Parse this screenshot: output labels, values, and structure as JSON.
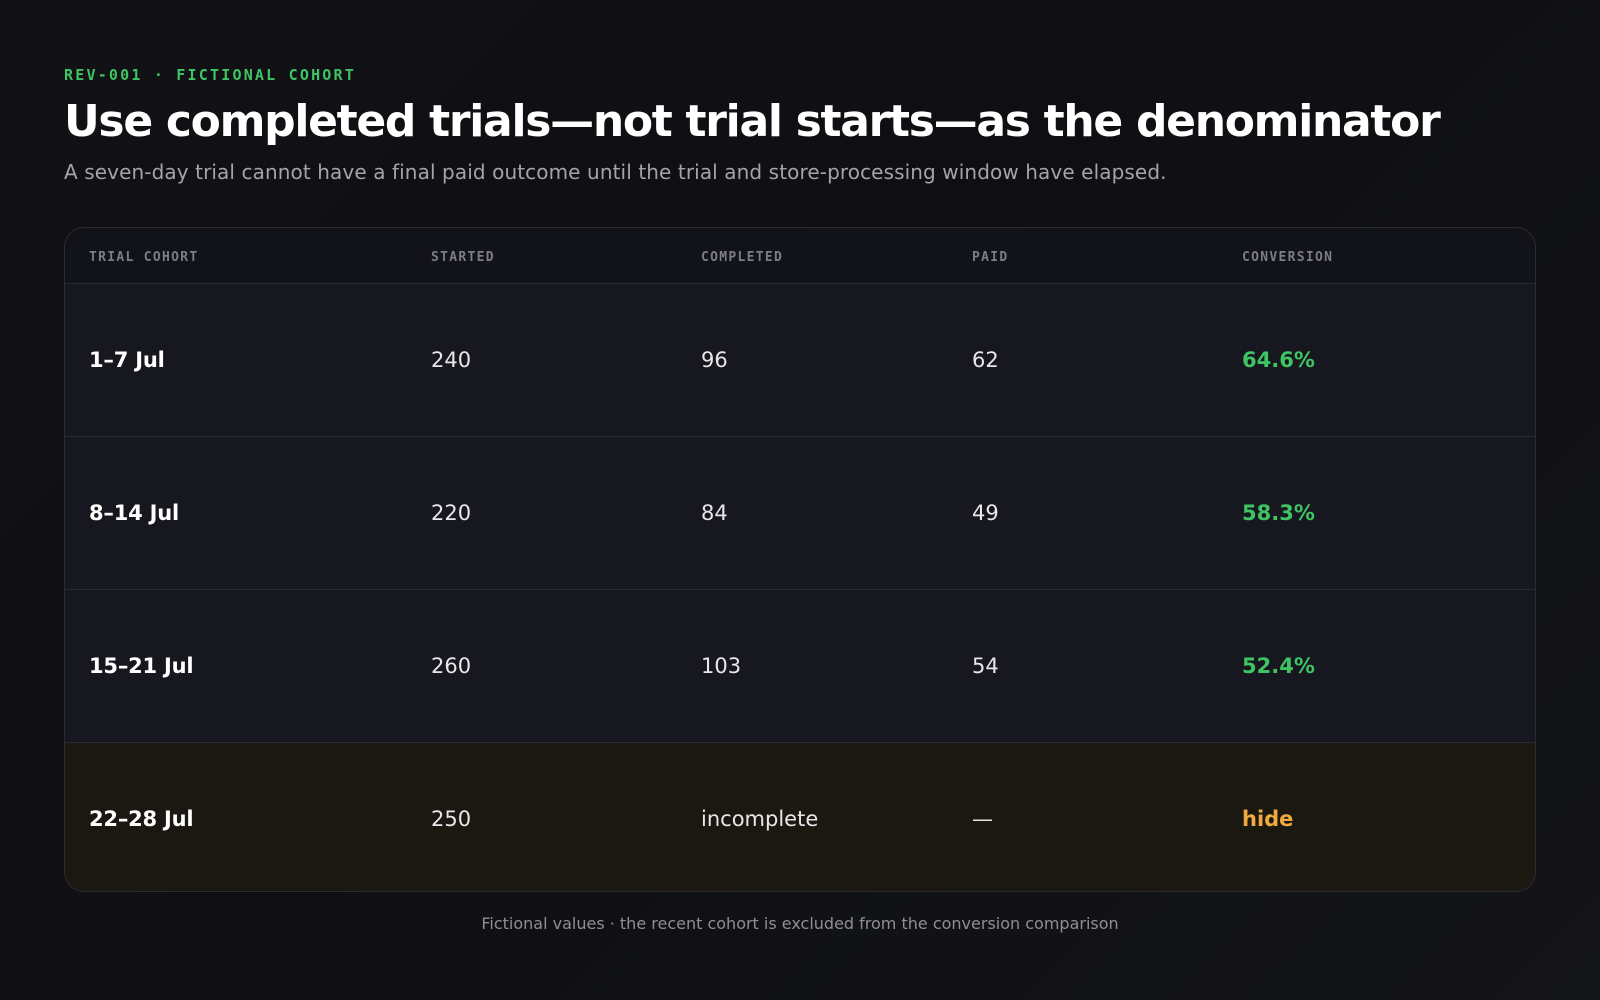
{
  "header": {
    "eyebrow": "REV-001 · FICTIONAL COHORT",
    "title": "Use completed trials—not trial starts—as the denominator",
    "subtitle": "A seven-day trial cannot have a final paid outcome until the trial and store-processing window have elapsed."
  },
  "table": {
    "columns": [
      "TRIAL COHORT",
      "STARTED",
      "COMPLETED",
      "PAID",
      "CONVERSION"
    ],
    "rows": [
      {
        "cohort": "1–7 Jul",
        "started": "240",
        "completed": "96",
        "paid": "62",
        "conversion": "64.6%"
      },
      {
        "cohort": "8–14 Jul",
        "started": "220",
        "completed": "84",
        "paid": "49",
        "conversion": "58.3%"
      },
      {
        "cohort": "15–21 Jul",
        "started": "260",
        "completed": "103",
        "paid": "54",
        "conversion": "52.4%"
      },
      {
        "cohort": "22–28 Jul",
        "started": "250",
        "completed": "incomplete",
        "paid": "—",
        "conversion": "hide"
      }
    ]
  },
  "colors": {
    "accent_green": "#3fc463",
    "warning_amber": "#efa93f",
    "background": "#121216"
  },
  "footnote": "Fictional values · the recent cohort is excluded from the conversion comparison"
}
